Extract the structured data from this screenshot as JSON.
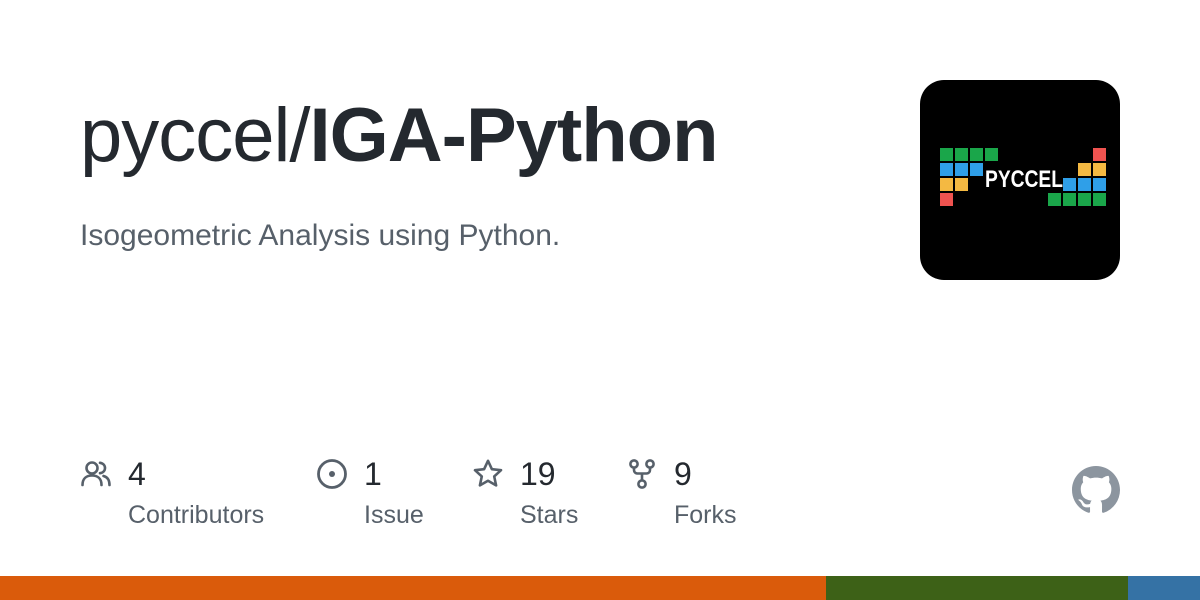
{
  "repo": {
    "owner": "pyccel/",
    "name": "IGA-Python",
    "description": "Isogeometric Analysis using Python."
  },
  "avatar": {
    "logo_text": "PYCCEL"
  },
  "stats": [
    {
      "icon": "people-icon",
      "value": "4",
      "label": "Contributors"
    },
    {
      "icon": "issue-opened-icon",
      "value": "1",
      "label": "Issue"
    },
    {
      "icon": "star-icon",
      "value": "19",
      "label": "Stars"
    },
    {
      "icon": "repo-forked-icon",
      "value": "9",
      "label": "Forks"
    }
  ],
  "language_bar": [
    {
      "color": "#DA5B0B",
      "fraction": 0.688
    },
    {
      "color": "#3D6117",
      "fraction": 0.252
    },
    {
      "color": "#3572A5",
      "fraction": 0.06
    }
  ],
  "colors": {
    "title": "#24292f",
    "muted": "#57606a",
    "icon": "#57606a",
    "github_mark": "#8c959f"
  }
}
